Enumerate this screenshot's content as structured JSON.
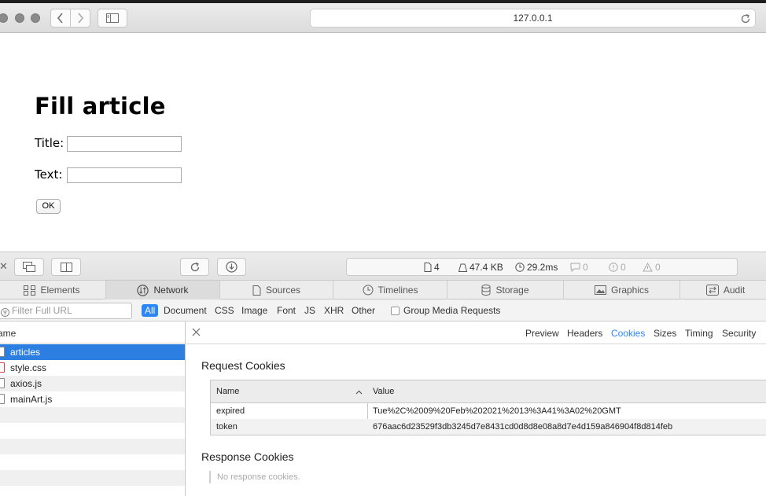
{
  "browser": {
    "address": "127.0.0.1"
  },
  "page": {
    "heading": "Fill article",
    "title_label": "Title:",
    "text_label": "Text:",
    "title_value": "",
    "text_value": "",
    "ok_label": "OK"
  },
  "devtools": {
    "summary": {
      "resources": "4",
      "size": "47.4 KB",
      "time": "29.2ms",
      "logs": "0",
      "errors": "0",
      "warnings": "0"
    },
    "tabs": [
      "Elements",
      "Network",
      "Sources",
      "Timelines",
      "Storage",
      "Graphics",
      "Audit"
    ],
    "active_tab": "Network",
    "filter_placeholder": "Filter Full URL",
    "types": [
      "All",
      "Document",
      "CSS",
      "Image",
      "Font",
      "JS",
      "XHR",
      "Other"
    ],
    "group_media": "Group Media Requests",
    "list_header": "ame",
    "requests": [
      {
        "name": "articles",
        "icon": "document-icon"
      },
      {
        "name": "style.css",
        "icon": "css-file-icon"
      },
      {
        "name": "axios.js",
        "icon": "js-file-icon"
      },
      {
        "name": "mainArt.js",
        "icon": "js-file-icon"
      }
    ],
    "detail_tabs": [
      "Preview",
      "Headers",
      "Cookies",
      "Sizes",
      "Timing",
      "Security"
    ],
    "active_detail_tab": "Cookies",
    "request_cookies_title": "Request Cookies",
    "cookie_columns": [
      "Name",
      "Value"
    ],
    "cookies": [
      {
        "name": "expired",
        "value": "Tue%2C%2009%20Feb%202021%2013%3A41%3A02%20GMT"
      },
      {
        "name": "token",
        "value": "676aac6d23529f3db3245d7e8431cd0d8d8e08a8d7e4d159a846904f8d814feb"
      }
    ],
    "response_cookies_title": "Response Cookies",
    "no_response": "No response cookies."
  },
  "colors": {
    "accent": "#2c86f5",
    "selection": "#2c7fe0"
  }
}
